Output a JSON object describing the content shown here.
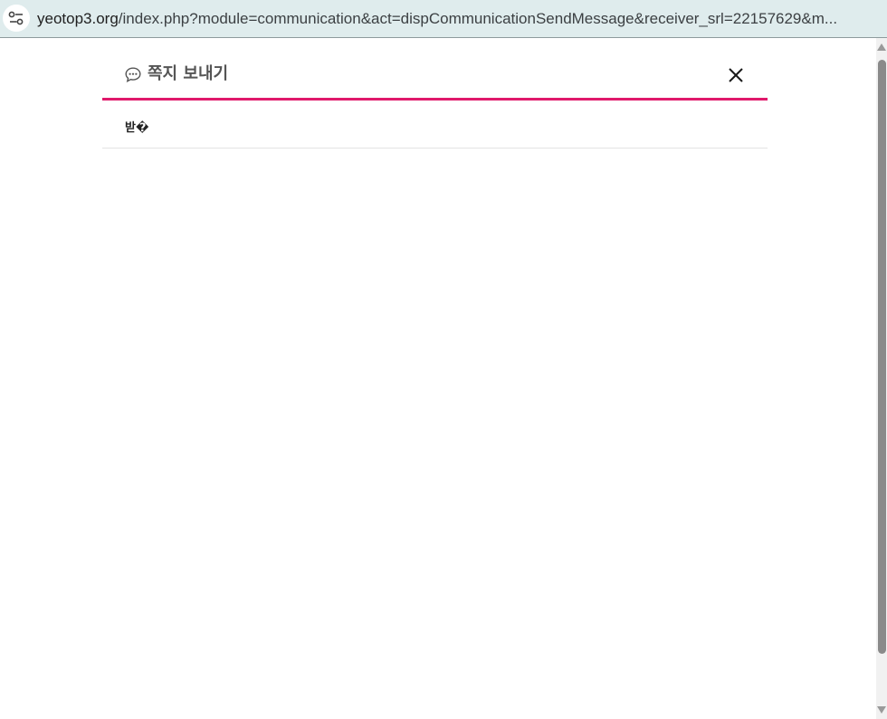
{
  "browser": {
    "url_host": "yeotop3.org",
    "url_rest": "/index.php?module=communication&act=dispCommunicationSendMessage&receiver_srl=22157629&m..."
  },
  "dialog": {
    "title": "쪽지 보내기",
    "title_icon": "speech-bubble-icon",
    "close_icon": "close-icon",
    "accent_color": "#e0196b",
    "fields": [
      {
        "label": "받�"
      }
    ]
  }
}
